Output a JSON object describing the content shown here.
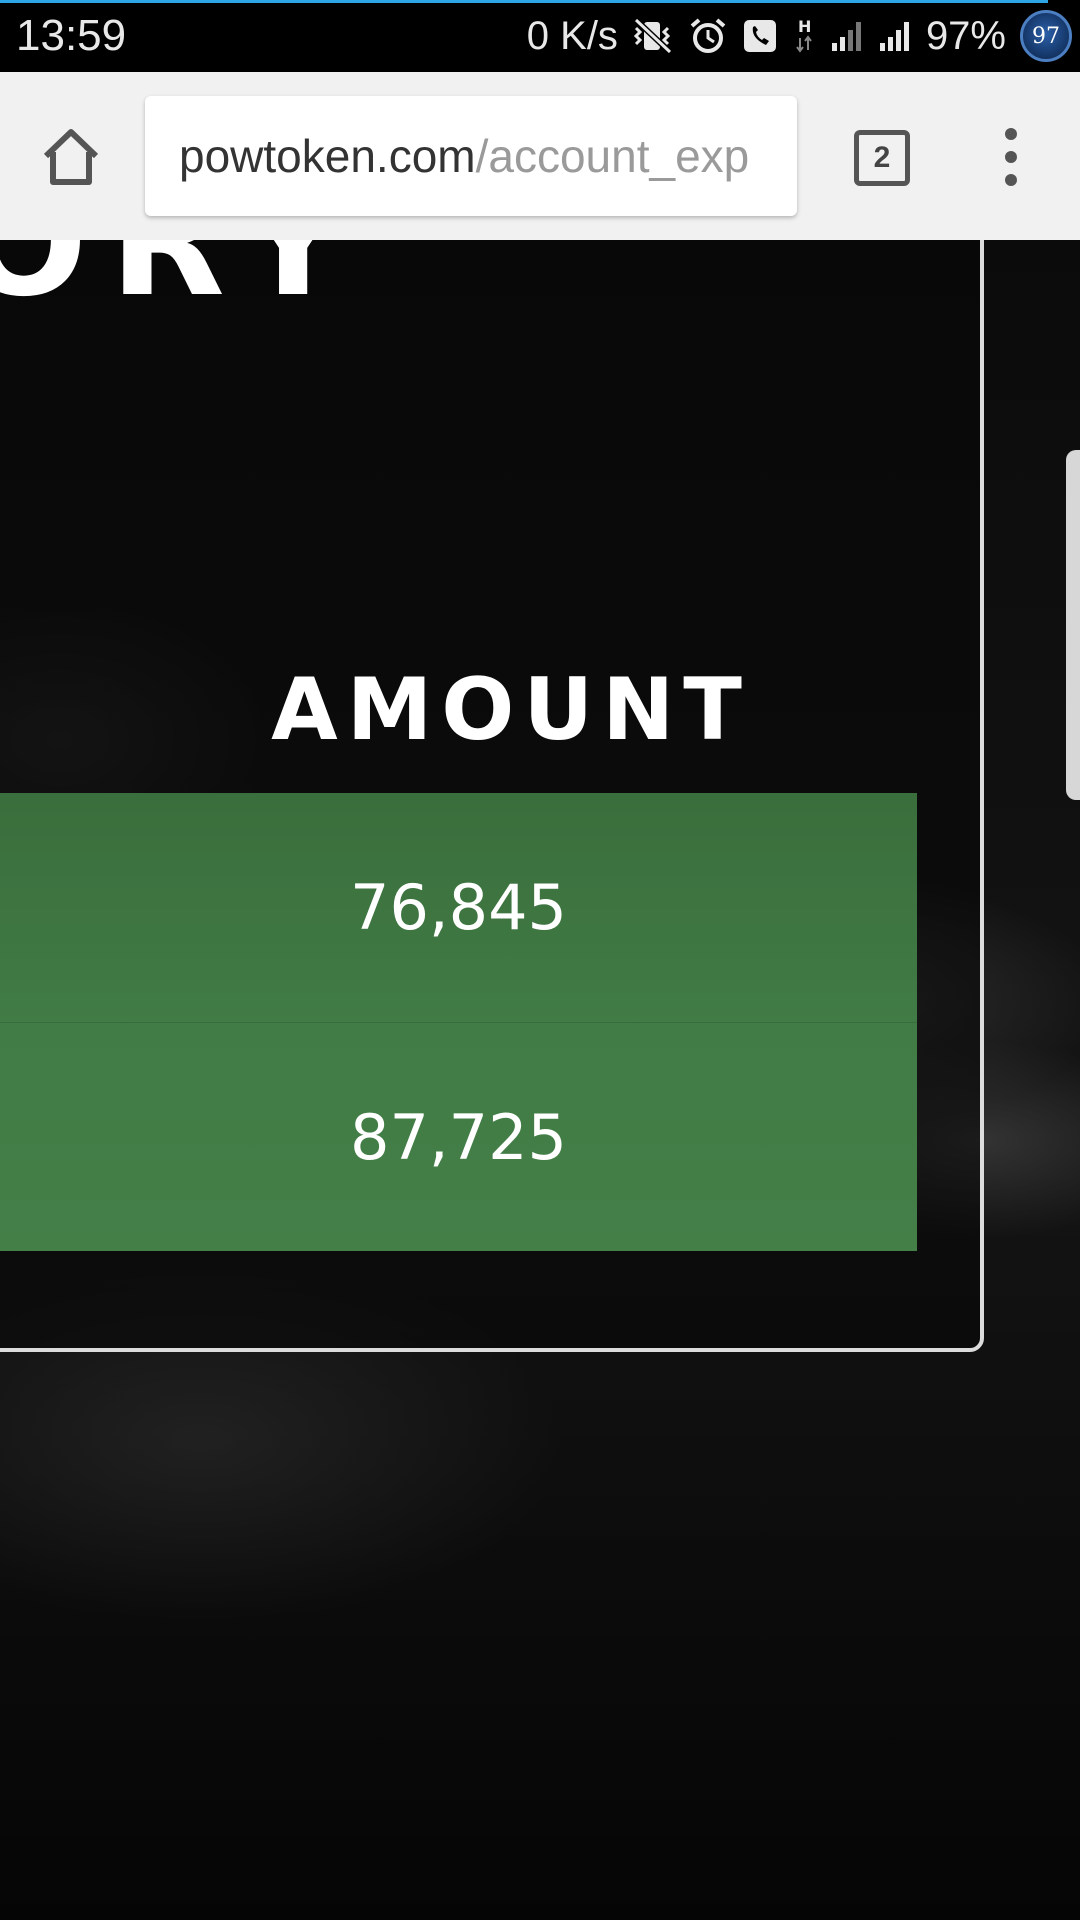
{
  "status_bar": {
    "time": "13:59",
    "network_speed": "0 K/s",
    "battery": "97%",
    "badge": "97",
    "icons": [
      "vibrate-off-icon",
      "alarm-icon",
      "call-icon",
      "hplus-data-icon",
      "signal-icon",
      "signal-icon-2"
    ]
  },
  "browser": {
    "url_host": "powtoken.com",
    "url_path": "/account_exp",
    "tab_count": "2",
    "icons": {
      "home": "home-icon",
      "menu": "more-vert-icon"
    }
  },
  "page": {
    "heading_fragment": "ORY",
    "column_header": "AMOUNT",
    "rows": [
      {
        "amount": "76,845"
      },
      {
        "amount": "87,725"
      }
    ],
    "colors": {
      "row_green": "#417b45",
      "panel_border": "#dcdcdc"
    }
  }
}
